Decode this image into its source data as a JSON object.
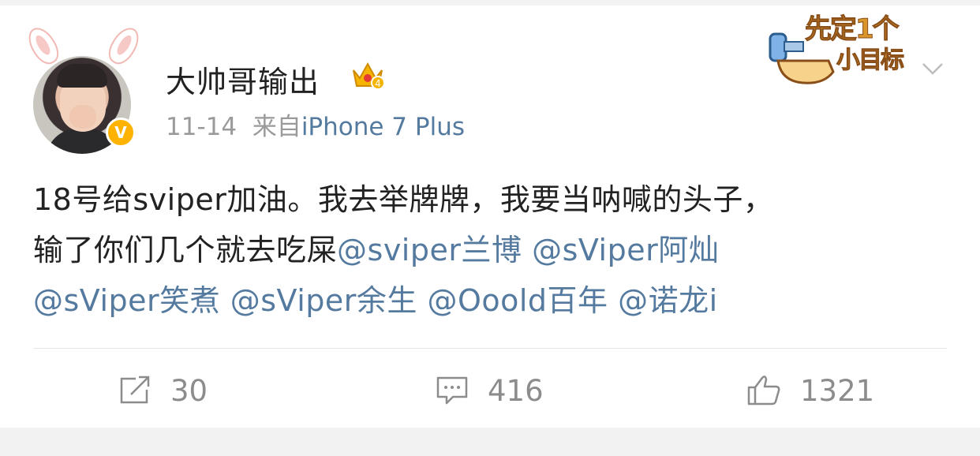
{
  "post": {
    "username": "大帅哥输出",
    "date": "11-14",
    "source_prefix": "来自",
    "device": "iPhone 7 Plus",
    "text_line1": "18号给sviper加油。我去举牌牌，我要当呐喊的头子，",
    "text_line2_plain": "输了你们几个就去吃屎",
    "mentions": [
      "@sviper兰博",
      "@sViper阿灿",
      "@sViper笑煮",
      "@sViper余生",
      "@Ooold百年",
      "@诺龙i"
    ],
    "badge_letter": "V",
    "crown_level": "4"
  },
  "sticker": {
    "line1": "先定1个",
    "line2": "小目标"
  },
  "actions": {
    "repost_count": "30",
    "comment_count": "416",
    "like_count": "1321"
  },
  "colors": {
    "link": "#557a9f",
    "badge": "#ffb300",
    "text": "#222222",
    "muted": "#9a9a9a"
  },
  "icons": [
    "avatar-bunny-ears",
    "verified-v-icon",
    "crown-icon",
    "more-chevron-icon",
    "repost-icon",
    "comment-icon",
    "like-icon"
  ]
}
